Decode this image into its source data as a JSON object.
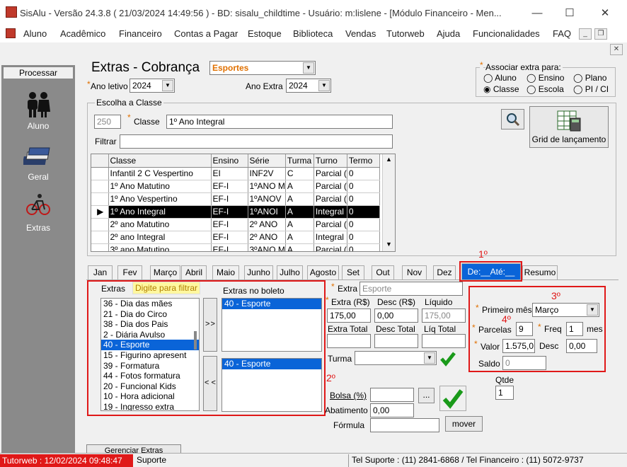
{
  "window": {
    "title": "SisAlu - Versão 24.3.8 ( 21/03/2024 14:49:56 ) - BD: sisalu_childtime - Usuário: m:lislene - [Módulo Financeiro - Men...",
    "minimize": "—",
    "maximize": "☐",
    "close": "✕"
  },
  "menu": [
    "Aluno",
    "Acadêmico",
    "Financeiro",
    "Contas a Pagar",
    "Estoque",
    "Biblioteca",
    "Vendas",
    "Tutorweb",
    "Ajuda",
    "Funcionalidades",
    "FAQ"
  ],
  "mdi": {
    "min": "_",
    "restore": "❐",
    "close": "✕"
  },
  "sidebar": {
    "header": "Processar",
    "items": [
      {
        "label": "Aluno",
        "icon": "people-icon"
      },
      {
        "label": "Geral",
        "icon": "money-stack-icon"
      },
      {
        "label": "Extras",
        "icon": "bicycle-icon"
      }
    ]
  },
  "form": {
    "title": "Extras - Cobrança",
    "extra_type": "Esportes",
    "ano_letivo_label": "Ano letivo",
    "ano_letivo": "2024",
    "ano_extra_label": "Ano Extra",
    "ano_extra": "2024",
    "associar": {
      "title": "Associar extra para:",
      "options": [
        "Aluno",
        "Ensino",
        "Plano",
        "Classe",
        "Escola",
        "PI / CI"
      ],
      "selected": "Classe"
    },
    "escolha_classe": {
      "title": "Escolha a Classe",
      "code": "250",
      "classe_label": "Classe",
      "classe_value": "1º Ano Integral",
      "filtrar_label": "Filtrar",
      "filtrar_value": ""
    },
    "grid_btn": "Grid de lançamento",
    "grid": {
      "columns": [
        "Classe",
        "Ensino",
        "Série",
        "Turma",
        "Turno",
        "Termo"
      ],
      "rows": [
        [
          "Infantil 2 C Vespertino",
          "EI",
          "INF2V",
          "C",
          "Parcial (",
          "0"
        ],
        [
          "1º Ano Matutino",
          "EF-I",
          "1ºANO M",
          "A",
          "Parcial (",
          "0"
        ],
        [
          "1º Ano Vespertino",
          "EF-I",
          "1ºANOV",
          "A",
          "Parcial (",
          "0"
        ],
        [
          "1º Ano Integral",
          "EF-I",
          "1ºANOI",
          "A",
          "Integral",
          "0"
        ],
        [
          "2º ano Matutino",
          "EF-I",
          "2º ANO",
          "A",
          "Parcial (",
          "0"
        ],
        [
          "2º ano Integral",
          "EF-I",
          "2º ANO",
          "A",
          "Integral",
          "0"
        ],
        [
          "3º ano Matutino",
          "EF-I",
          "3ºANO M",
          "A",
          "Parcial (",
          "0"
        ]
      ],
      "selected_index": 3
    },
    "tabs": [
      "Jan",
      "Fev",
      "Março",
      "Abril",
      "Maio",
      "Junho",
      "Julho",
      "Agosto",
      "Set",
      "Out",
      "Nov",
      "Dez",
      "De:__Até:__",
      "Resumo"
    ],
    "active_tab": "De:__Até:__",
    "extras_label": "Extras",
    "filter_placeholder": "Digite para filtrar",
    "extras_list": [
      "36 - Dia das mães",
      "21 - Dia do Circo",
      "38 - Dia dos Pais",
      "2 - Diária Avulso",
      "40 - Esporte",
      "15 - Figurino apresent",
      "39 - Formatura",
      "44 - Fotos formatura",
      "20 - Funcional Kids",
      "10 - Hora adicional",
      "19 - Ingresso extra"
    ],
    "extras_selected": "40 - Esporte",
    "boleto_label": "Extras no boleto",
    "boleto_top": [
      "40 - Esporte"
    ],
    "boleto_bottom": [
      "40 - Esporte"
    ],
    "move_right": "> >",
    "move_left": "< <",
    "extra_label": "Extra",
    "extra_value": "Esporte",
    "extra_rs_label": "Extra (R$)",
    "extra_rs": "175,00",
    "desc_rs_label": "Desc (R$)",
    "desc_rs": "0,00",
    "liquido_label": "Líquido",
    "liquido": "175,00",
    "extra_total_label": "Extra Total",
    "desc_total_label": "Desc Total",
    "liq_total_label": "Líq Total",
    "turma_label": "Turma",
    "bolsa_label": "Bolsa (%)",
    "ellipsis": "...",
    "abatimento_label": "Abatimento",
    "abatimento": "0,00",
    "formula_label": "Fórmula",
    "mover_btn": "mover",
    "primeiro_mes_label": "Primeiro mês",
    "primeiro_mes": "Março",
    "parcelas_label": "Parcelas",
    "parcelas": "9",
    "freq_label": "Freq",
    "freq": "1",
    "mes_label": "mes",
    "valor_label": "Valor",
    "valor": "1.575,0",
    "desc_label": "Desc",
    "desc": "0,00",
    "saldo_label": "Saldo",
    "saldo": "0",
    "qtde_label": "Qtde",
    "qtde": "1",
    "gerenciar_btn": "Gerenciar Extras"
  },
  "annotations": [
    "1º",
    "2º",
    "3º",
    "4º"
  ],
  "status": {
    "tutorweb": "Tutorweb : 12/02/2024 09:48:47",
    "suporte": "Suporte",
    "tel": "Tel Suporte : (11) 2841-6868 / Tel Financeiro : (11) 5072-9737"
  },
  "colors": {
    "annotation_red": "#e01818",
    "required_orange": "#e07000",
    "selection_blue": "#0a64d8",
    "status_red": "#e01818"
  }
}
